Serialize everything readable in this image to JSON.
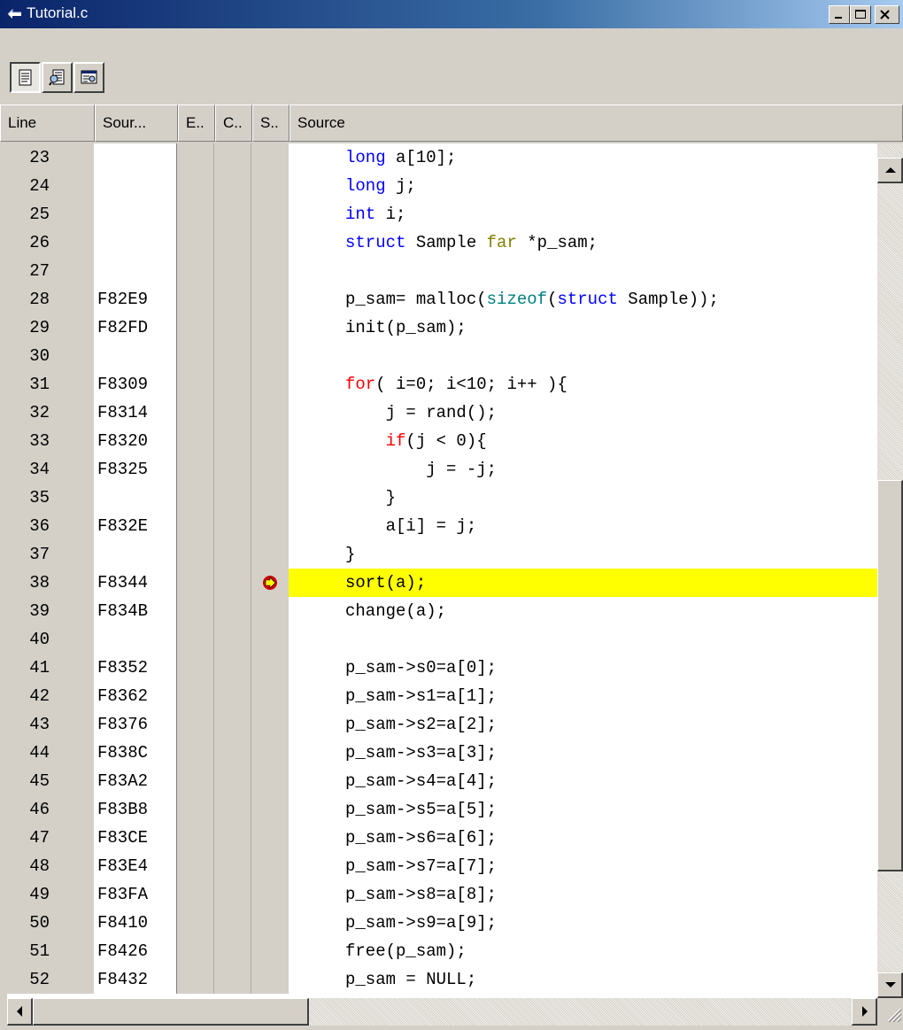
{
  "window": {
    "title": "Tutorial.c",
    "title_icon": "source-file-icon",
    "controls": [
      "minimize-icon",
      "maximize-icon",
      "close-icon"
    ]
  },
  "toolbar": {
    "buttons": [
      {
        "name": "source-view-icon",
        "pressed": true
      },
      {
        "name": "mixed-view-icon",
        "pressed": false
      },
      {
        "name": "disassembly-view-icon",
        "pressed": false
      }
    ]
  },
  "columns": [
    "Line",
    "Sour...",
    "E..",
    "C..",
    "S..",
    "Source"
  ],
  "current_line": 38,
  "rows": [
    {
      "line": "23",
      "addr": "",
      "code": [
        {
          "t": "long",
          "c": "blue"
        },
        {
          "t": " a[10];"
        }
      ]
    },
    {
      "line": "24",
      "addr": "",
      "code": [
        {
          "t": "long",
          "c": "blue"
        },
        {
          "t": " j;"
        }
      ]
    },
    {
      "line": "25",
      "addr": "",
      "code": [
        {
          "t": "int",
          "c": "blue"
        },
        {
          "t": " i;"
        }
      ]
    },
    {
      "line": "26",
      "addr": "",
      "code": [
        {
          "t": "struct",
          "c": "blue"
        },
        {
          "t": " Sample "
        },
        {
          "t": "far",
          "c": "olive"
        },
        {
          "t": " *p_sam;"
        }
      ]
    },
    {
      "line": "27",
      "addr": "",
      "code": []
    },
    {
      "line": "28",
      "addr": "F82E9",
      "code": [
        {
          "t": "p_sam= malloc("
        },
        {
          "t": "sizeof",
          "c": "teal"
        },
        {
          "t": "("
        },
        {
          "t": "struct",
          "c": "blue"
        },
        {
          "t": " Sample));"
        }
      ]
    },
    {
      "line": "29",
      "addr": "F82FD",
      "code": [
        {
          "t": "init(p_sam);"
        }
      ]
    },
    {
      "line": "30",
      "addr": "",
      "code": []
    },
    {
      "line": "31",
      "addr": "F8309",
      "code": [
        {
          "t": "for",
          "c": "red"
        },
        {
          "t": "( i=0; i<10; i++ ){"
        }
      ]
    },
    {
      "line": "32",
      "addr": "F8314",
      "code": [
        {
          "t": "    j = rand();"
        }
      ]
    },
    {
      "line": "33",
      "addr": "F8320",
      "code": [
        {
          "t": "    "
        },
        {
          "t": "if",
          "c": "red"
        },
        {
          "t": "(j < 0){"
        }
      ]
    },
    {
      "line": "34",
      "addr": "F8325",
      "code": [
        {
          "t": "        j = -j;"
        }
      ]
    },
    {
      "line": "35",
      "addr": "",
      "code": [
        {
          "t": "    }"
        }
      ]
    },
    {
      "line": "36",
      "addr": "F832E",
      "code": [
        {
          "t": "    a[i] = j;"
        }
      ]
    },
    {
      "line": "37",
      "addr": "",
      "code": [
        {
          "t": "}"
        }
      ]
    },
    {
      "line": "38",
      "addr": "F8344",
      "code": [
        {
          "t": "sort(a);"
        }
      ]
    },
    {
      "line": "39",
      "addr": "F834B",
      "code": [
        {
          "t": "change(a);"
        }
      ]
    },
    {
      "line": "40",
      "addr": "",
      "code": []
    },
    {
      "line": "41",
      "addr": "F8352",
      "code": [
        {
          "t": "p_sam->s0=a[0];"
        }
      ]
    },
    {
      "line": "42",
      "addr": "F8362",
      "code": [
        {
          "t": "p_sam->s1=a[1];"
        }
      ]
    },
    {
      "line": "43",
      "addr": "F8376",
      "code": [
        {
          "t": "p_sam->s2=a[2];"
        }
      ]
    },
    {
      "line": "44",
      "addr": "F838C",
      "code": [
        {
          "t": "p_sam->s3=a[3];"
        }
      ]
    },
    {
      "line": "45",
      "addr": "F83A2",
      "code": [
        {
          "t": "p_sam->s4=a[4];"
        }
      ]
    },
    {
      "line": "46",
      "addr": "F83B8",
      "code": [
        {
          "t": "p_sam->s5=a[5];"
        }
      ]
    },
    {
      "line": "47",
      "addr": "F83CE",
      "code": [
        {
          "t": "p_sam->s6=a[6];"
        }
      ]
    },
    {
      "line": "48",
      "addr": "F83E4",
      "code": [
        {
          "t": "p_sam->s7=a[7];"
        }
      ]
    },
    {
      "line": "49",
      "addr": "F83FA",
      "code": [
        {
          "t": "p_sam->s8=a[8];"
        }
      ]
    },
    {
      "line": "50",
      "addr": "F8410",
      "code": [
        {
          "t": "p_sam->s9=a[9];"
        }
      ]
    },
    {
      "line": "51",
      "addr": "F8426",
      "code": [
        {
          "t": "free(p_sam);"
        }
      ]
    },
    {
      "line": "52",
      "addr": "F8432",
      "code": [
        {
          "t": "p_sam = NULL;"
        }
      ]
    }
  ],
  "colors": {
    "keyword_blue": "#0000ff",
    "keyword_red": "#ff0000",
    "keyword_teal": "#008080",
    "keyword_olive": "#808000",
    "current_line_highlight": "#ffff00",
    "pc_arrow": "#cc0000"
  }
}
